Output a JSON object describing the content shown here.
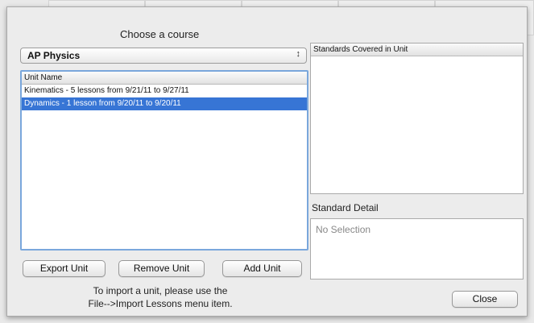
{
  "dialog": {
    "title": "Choose a course",
    "course_select": {
      "selected": "AP Physics"
    },
    "units": {
      "column_header": "Unit Name",
      "rows": [
        {
          "label": "Kinematics - 5 lessons from 9/21/11 to 9/27/11",
          "selected": false
        },
        {
          "label": "Dynamics - 1 lesson from 9/20/11 to 9/20/11",
          "selected": true
        }
      ]
    },
    "standards": {
      "column_header": "Standards Covered in Unit"
    },
    "detail": {
      "label": "Standard Detail",
      "placeholder": "No Selection"
    },
    "buttons": {
      "export": "Export Unit",
      "remove": "Remove Unit",
      "add": "Add Unit",
      "close": "Close"
    },
    "hint_line1": "To import a unit, please use the",
    "hint_line2": "File-->Import Lessons menu item."
  },
  "colors": {
    "selection": "#3775d5",
    "focus_ring": "#7aa7dc"
  }
}
